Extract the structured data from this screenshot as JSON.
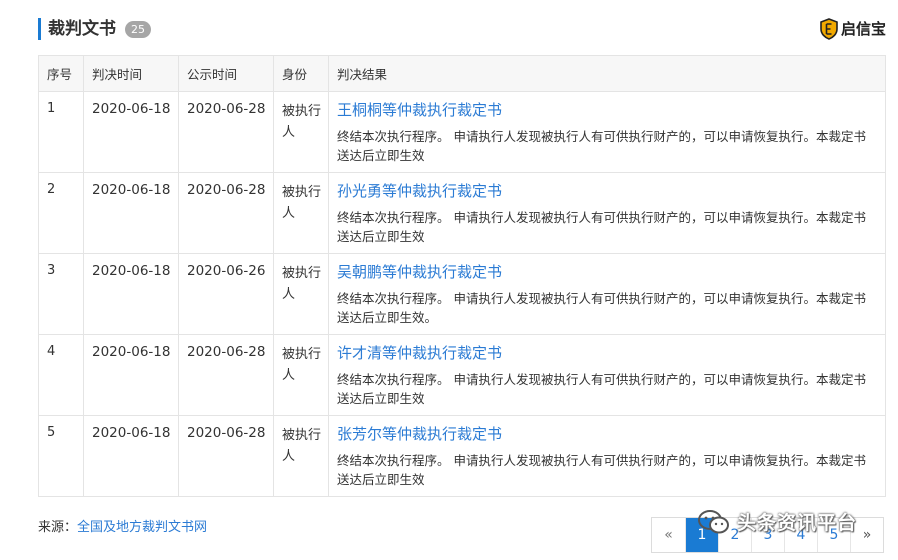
{
  "header": {
    "title": "裁判文书",
    "count": "25",
    "brand": "启信宝",
    "accent_color": "#1a7bd3"
  },
  "table": {
    "columns": [
      "序号",
      "判决时间",
      "公示时间",
      "身份",
      "判决结果"
    ],
    "rows": [
      {
        "index": "1",
        "judgment_date": "2020-06-18",
        "publish_date": "2020-06-28",
        "role": "被执行人",
        "title": "王桐桐等仲裁执行裁定书",
        "summary": "终结本次执行程序。 申请执行人发现被执行人有可供执行财产的，可以申请恢复执行。本裁定书送达后立即生效"
      },
      {
        "index": "2",
        "judgment_date": "2020-06-18",
        "publish_date": "2020-06-28",
        "role": "被执行人",
        "title": "孙光勇等仲裁执行裁定书",
        "summary": "终结本次执行程序。 申请执行人发现被执行人有可供执行财产的，可以申请恢复执行。本裁定书送达后立即生效"
      },
      {
        "index": "3",
        "judgment_date": "2020-06-18",
        "publish_date": "2020-06-26",
        "role": "被执行人",
        "title": "吴朝鹏等仲裁执行裁定书",
        "summary": "终结本次执行程序。 申请执行人发现被执行人有可供执行财产的，可以申请恢复执行。本裁定书送达后立即生效。"
      },
      {
        "index": "4",
        "judgment_date": "2020-06-18",
        "publish_date": "2020-06-28",
        "role": "被执行人",
        "title": "许才清等仲裁执行裁定书",
        "summary": "终结本次执行程序。 申请执行人发现被执行人有可供执行财产的，可以申请恢复执行。本裁定书送达后立即生效"
      },
      {
        "index": "5",
        "judgment_date": "2020-06-18",
        "publish_date": "2020-06-28",
        "role": "被执行人",
        "title": "张芳尔等仲裁执行裁定书",
        "summary": "终结本次执行程序。 申请执行人发现被执行人有可供执行财产的，可以申请恢复执行。本裁定书送达后立即生效"
      }
    ]
  },
  "source": {
    "label": "来源：",
    "link": "全国及地方裁判文书网"
  },
  "pagination": {
    "prev": "«",
    "pages": [
      "1",
      "2",
      "3",
      "4",
      "5"
    ],
    "current": "1",
    "next": "»"
  },
  "watermark": {
    "text": "头条资讯平台",
    "icon": "wechat-icon"
  }
}
